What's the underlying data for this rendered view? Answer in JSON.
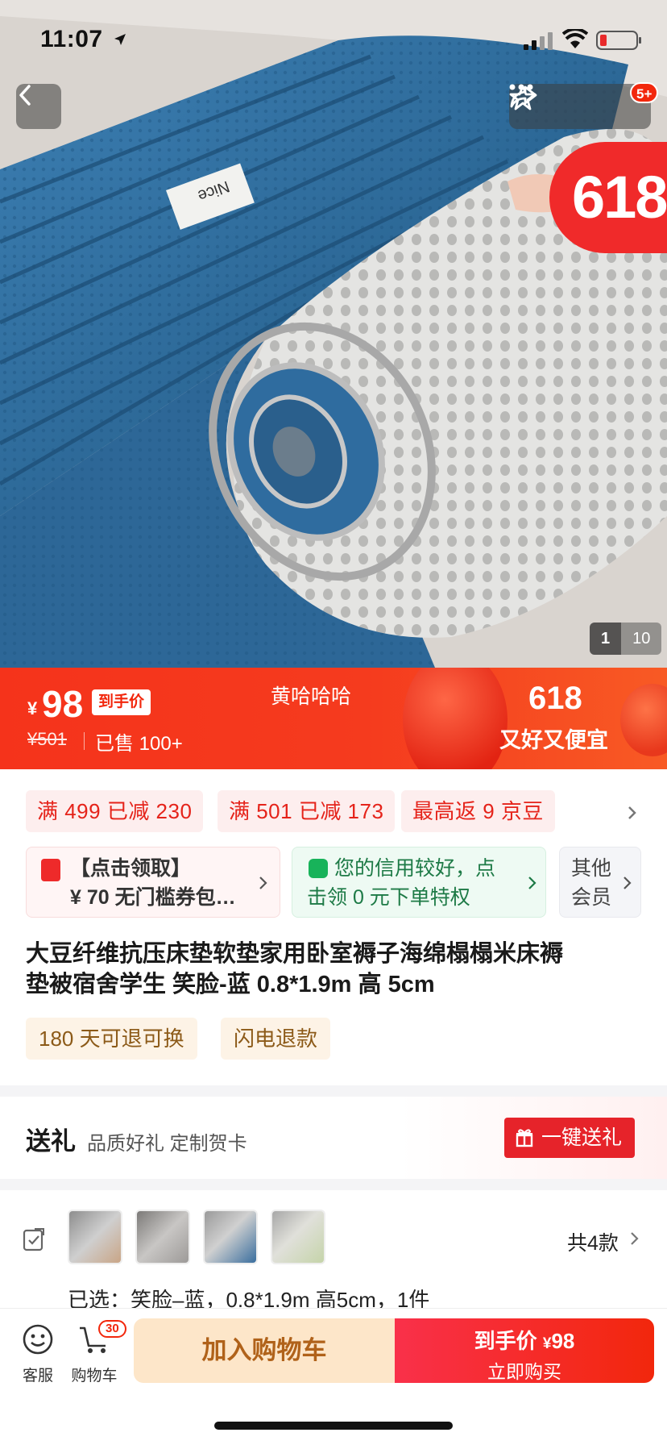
{
  "status_bar": {
    "time": "11:07"
  },
  "hero": {
    "notification_count": "5+",
    "promo_badge": "618",
    "image_index": "1",
    "image_total": "10",
    "label_on_product": "Nice"
  },
  "price_banner": {
    "currency": "¥",
    "price": "98",
    "price_tag": "到手价",
    "original_price": "¥501",
    "sold": "已售 100+",
    "shop_name": "黄哈哈哈",
    "event": "618",
    "slogan": "又好又便宜"
  },
  "promotions": {
    "chips": [
      "满 499 已减 230",
      "满 501 已减 173",
      "最高返 9 京豆"
    ],
    "coupon_card": [
      "【点击领取】",
      "¥ 70 无门槛券包…"
    ],
    "credit_card": [
      "您的信用较好，点",
      "击领 0 元下单特权"
    ],
    "member_card": [
      "其他",
      "会员"
    ]
  },
  "product": {
    "title_line1": "大豆纤维抗压床垫软垫家用卧室褥子海绵榻榻米床褥",
    "title_line2": "垫被宿舍学生 笑脸-蓝 0.8*1.9m 高 5cm",
    "services": [
      "180 天可退可换",
      "闪电退款"
    ]
  },
  "gift": {
    "heading": "送礼",
    "subtitle": "品质好礼 定制贺卡",
    "button": "一键送礼"
  },
  "variants": {
    "count": "共4款",
    "selected": "已选：笑脸–蓝，0.8*1.9m 高5cm，1件",
    "thumb_colors": [
      "#c9a586",
      "#9d9a98",
      "#3a6e9e",
      "#c5d4a9"
    ]
  },
  "bottom_bar": {
    "service": "客服",
    "cart": "购物车",
    "cart_count": "30",
    "add_to_cart": "加入购物车",
    "buy_price_label": "到手价",
    "buy_currency": "¥",
    "buy_price": "98",
    "buy_now": "立即购买"
  },
  "colors": {
    "accent_red": "#f2270c",
    "product_blue": "#2f6c9f",
    "mesh_gray": "#d8d8d8"
  }
}
